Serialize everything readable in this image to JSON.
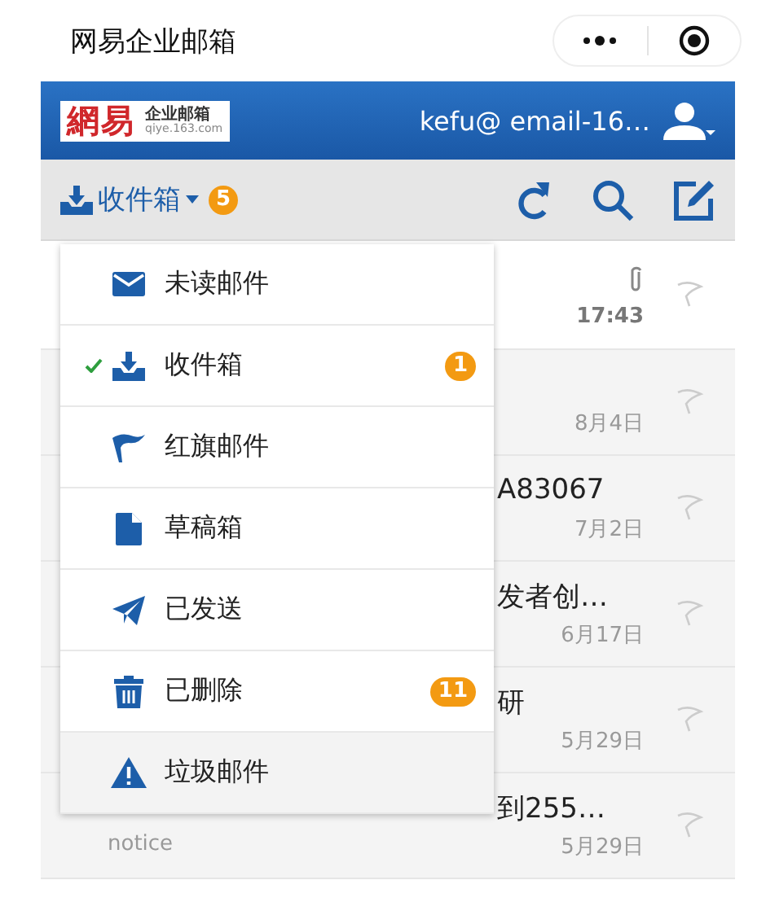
{
  "app_bar": {
    "title": "网易企业邮箱"
  },
  "header": {
    "logo": {
      "mark": "網易",
      "name": "企业邮箱",
      "domain": "qiye.163.com"
    },
    "account": "kefu@ email-16…"
  },
  "toolbar": {
    "folder": "收件箱",
    "badge": "5"
  },
  "mails": [
    {
      "date": "17:43",
      "attachment": true,
      "unread": true,
      "flagged": false
    },
    {
      "date": "8月4日",
      "attachment": false,
      "unread": false,
      "flagged": false
    },
    {
      "subject": "A83067",
      "date": "7月2日",
      "attachment": false,
      "unread": false,
      "flagged": false
    },
    {
      "subject": "发者创…",
      "date": "6月17日",
      "attachment": false,
      "unread": false,
      "flagged": false
    },
    {
      "subject": "研",
      "date": "5月29日",
      "attachment": false,
      "unread": false,
      "flagged": false
    },
    {
      "subject": "到255…",
      "sender": "notice",
      "date": "5月29日",
      "attachment": false,
      "unread": false,
      "flagged": false
    }
  ],
  "folder_menu": [
    {
      "label": "未读邮件",
      "selected": false,
      "highlighted": false
    },
    {
      "label": "收件箱",
      "selected": true,
      "highlighted": false,
      "badge": "1"
    },
    {
      "label": "红旗邮件",
      "selected": false,
      "highlighted": false
    },
    {
      "label": "草稿箱",
      "selected": false,
      "highlighted": false
    },
    {
      "label": "已发送",
      "selected": false,
      "highlighted": false
    },
    {
      "label": "已删除",
      "selected": false,
      "highlighted": false,
      "badge": "11"
    },
    {
      "label": "垃圾邮件",
      "selected": false,
      "highlighted": true
    }
  ]
}
